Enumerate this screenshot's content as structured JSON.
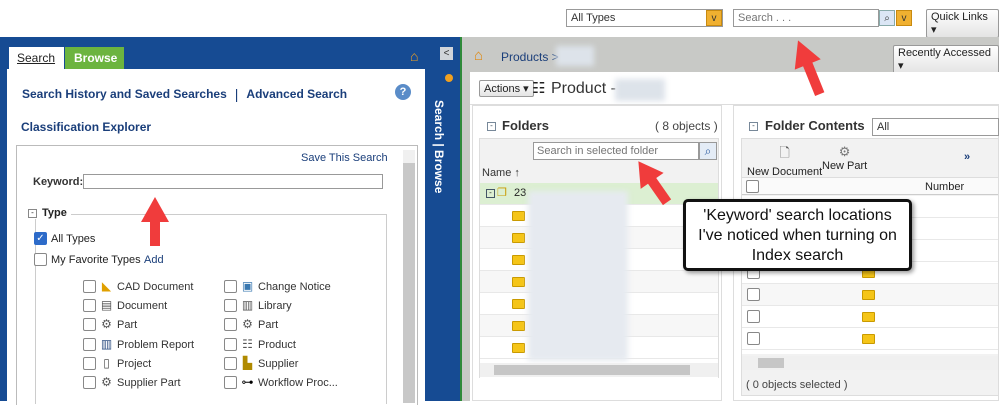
{
  "header": {
    "type_select": "All Types",
    "search_placeholder": "Search . . .",
    "quick_links": "Quick Links"
  },
  "left": {
    "tabs": [
      {
        "label": "Search"
      },
      {
        "label": "Browse"
      }
    ],
    "links": {
      "history": "Search History and Saved Searches",
      "separator": "|",
      "advanced": "Advanced Search",
      "classification": "Classification Explorer"
    },
    "save_search": "Save This Search",
    "keyword_label": "Keyword:",
    "keyword_value": "",
    "type_legend": "Type",
    "all_types": "All Types",
    "favorite_types": "My Favorite Types",
    "add": "Add",
    "types_col1": [
      "CAD Document",
      "Document",
      "Part",
      "Problem Report",
      "Project",
      "Supplier Part"
    ],
    "types_col2": [
      "Change Notice",
      "Library",
      "Part",
      "Product",
      "Supplier",
      "Workflow Proc..."
    ],
    "vertical_label": "Search | Browse"
  },
  "right": {
    "breadcrumb": "Products >",
    "recently_accessed": "Recently Accessed",
    "actions": "Actions",
    "title": "Product -",
    "folders": {
      "title": "Folders",
      "count": "( 8 objects )",
      "search_placeholder": "Search in selected folder",
      "name_col": "Name",
      "sort": "↑",
      "root": "23"
    },
    "contents": {
      "title": "Folder Contents",
      "filter": "All",
      "new_document": "New Document",
      "new_part": "New Part",
      "more": "»",
      "number_col": "Number",
      "selected": "( 0 objects selected )"
    }
  },
  "callout": {
    "text": "'Keyword' search locations I've noticed when turning on Index search"
  },
  "colors": {
    "blue": "#164b93",
    "green": "#6cb43f",
    "arrow": "#f03c3c"
  }
}
